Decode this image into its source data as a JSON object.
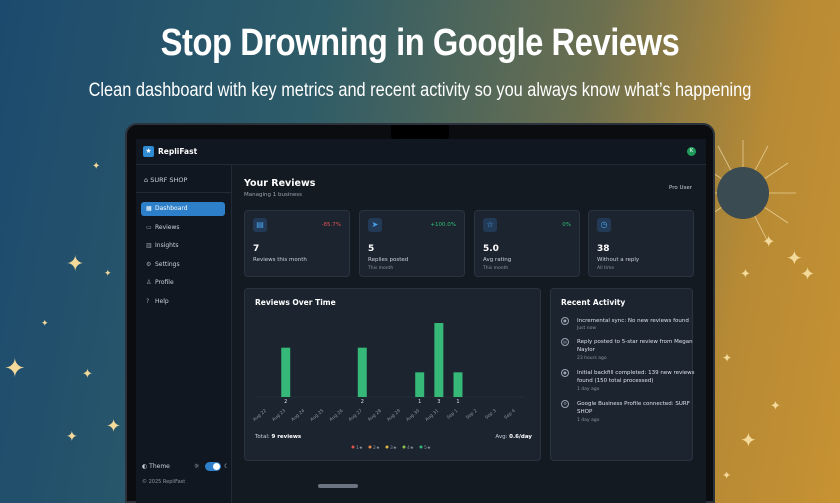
{
  "promo": {
    "headline": "Stop Drowning in Google Reviews",
    "subheadline": "Clean dashboard with key metrics and recent activity so you always know what’s happening"
  },
  "app": {
    "brand": "RepliFast",
    "user_initial": "K",
    "business_name": "SURF SHOP",
    "copyright": "© 2025 RepliFast"
  },
  "sidebar": {
    "items": [
      {
        "label": "Dashboard",
        "icon": "dashboard-icon",
        "active": true
      },
      {
        "label": "Reviews",
        "icon": "chat-icon",
        "active": false
      },
      {
        "label": "Insights",
        "icon": "bar-chart-icon",
        "active": false
      },
      {
        "label": "Settings",
        "icon": "gear-icon",
        "active": false
      },
      {
        "label": "Profile",
        "icon": "user-icon",
        "active": false
      },
      {
        "label": "Help",
        "icon": "help-icon",
        "active": false
      }
    ],
    "theme_label": "Theme"
  },
  "header": {
    "title": "Your Reviews",
    "subtitle": "Managing 1 business",
    "plan": "Pro User"
  },
  "metrics": [
    {
      "value": "7",
      "label": "Reviews this month",
      "sub": "",
      "delta": "-85.7%",
      "delta_color": "#e05252",
      "icon": "document-icon"
    },
    {
      "value": "5",
      "label": "Replies posted",
      "sub": "This month",
      "delta": "+100.0%",
      "delta_color": "#2fbf71",
      "icon": "send-icon"
    },
    {
      "value": "5.0",
      "label": "Avg rating",
      "sub": "This month",
      "delta": "0%",
      "delta_color": "#2fbf71",
      "icon": "star-icon"
    },
    {
      "value": "38",
      "label": "Without a reply",
      "sub": "All time",
      "delta": "",
      "delta_color": "#2fbf71",
      "icon": "clock-icon"
    }
  ],
  "chart_panel": {
    "title": "Reviews Over Time",
    "total_label": "Total:",
    "total_value": "9 reviews",
    "avg_label": "Avg:",
    "avg_value": "0.6/day"
  },
  "chart_data": {
    "type": "bar",
    "title": "Reviews Over Time",
    "categories": [
      "Aug 22",
      "Aug 23",
      "Aug 24",
      "Aug 25",
      "Aug 26",
      "Aug 27",
      "Aug 28",
      "Aug 29",
      "Aug 30",
      "Aug 31",
      "Sep 1",
      "Sep 2",
      "Sep 3",
      "Sep 4"
    ],
    "values": [
      0,
      2,
      0,
      0,
      0,
      2,
      0,
      0,
      1,
      3,
      1,
      0,
      0,
      0
    ],
    "bar_color": "#35b878",
    "ylim": [
      0,
      3
    ],
    "legend": [
      {
        "label": "1★",
        "color": "#e05252"
      },
      {
        "label": "2★",
        "color": "#e8894a"
      },
      {
        "label": "3★",
        "color": "#e0b542"
      },
      {
        "label": "4★",
        "color": "#8fc34a"
      },
      {
        "label": "5★",
        "color": "#35b878"
      }
    ]
  },
  "activity": {
    "title": "Recent Activity",
    "items": [
      {
        "text": "Incremental sync: No new reviews found",
        "time": "Just now",
        "icon": "sync-icon"
      },
      {
        "text": "Reply posted to 5-star review from Megan Naylor",
        "time": "23 hours ago",
        "icon": "reply-icon"
      },
      {
        "text": "Initial backfill completed: 139 new reviews found (150 total processed)",
        "time": "1 day ago",
        "icon": "sync-icon"
      },
      {
        "text": "Google Business Profile connected: SURF SHOP",
        "time": "1 day ago",
        "icon": "gear-icon"
      }
    ]
  }
}
